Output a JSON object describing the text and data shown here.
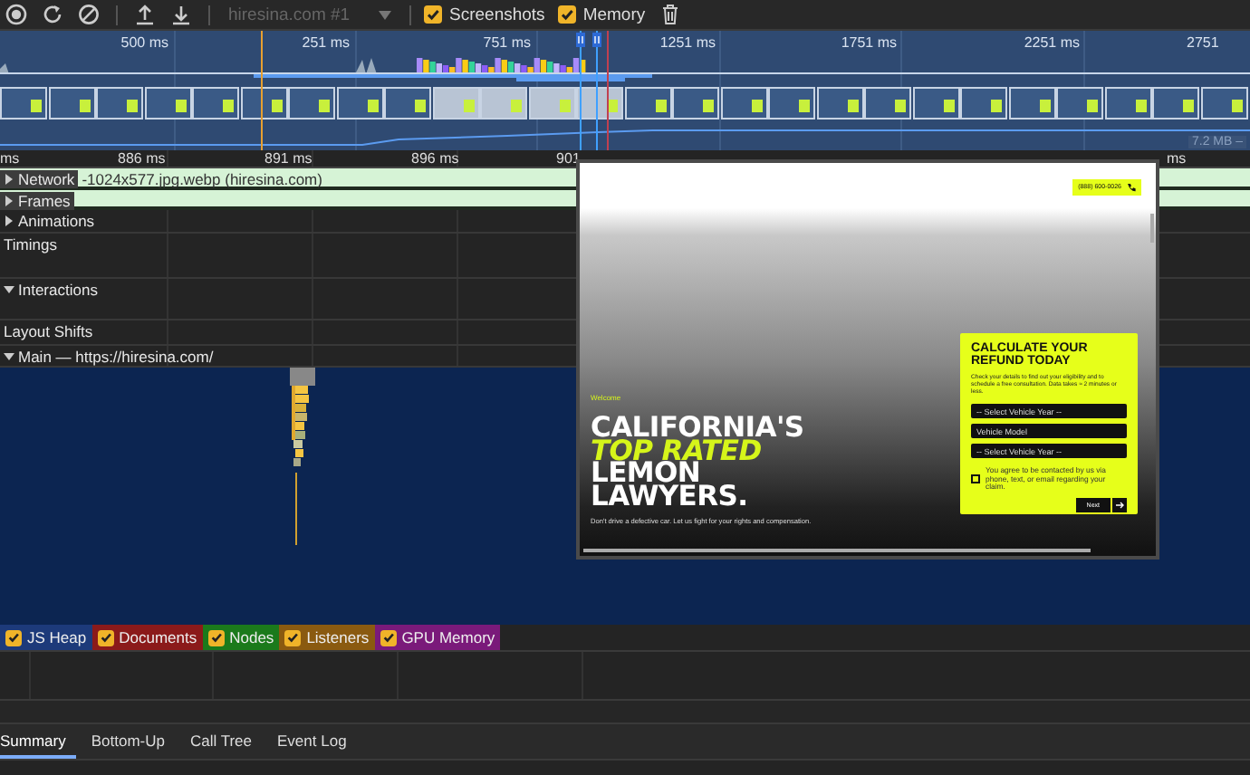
{
  "toolbar": {
    "target": "hiresina.com #1",
    "checkboxes": [
      {
        "label": "Screenshots",
        "checked": true
      },
      {
        "label": "Memory",
        "checked": true
      }
    ]
  },
  "overview": {
    "ticks": [
      "500 ms",
      "251 ms",
      "751 ms",
      "1251 ms",
      "1751 ms",
      "2251 ms",
      "2751"
    ],
    "memory_label": "7.2 MB –"
  },
  "ruler": {
    "ticks": [
      "ms",
      "886 ms",
      "891 ms",
      "896 ms",
      "901",
      "ms"
    ]
  },
  "tracks": [
    {
      "label": "Network",
      "kind": "expandable",
      "expanded": false,
      "highlighted": true,
      "detail": "-1024x577.jpg.webp (hiresina.com)"
    },
    {
      "label": "Frames",
      "kind": "expandable",
      "expanded": false,
      "highlighted": true
    },
    {
      "label": "Animations",
      "kind": "expandable",
      "expanded": false,
      "highlighted": false
    },
    {
      "label": "Timings",
      "kind": "plain",
      "highlighted": false
    },
    {
      "label": "Interactions",
      "kind": "expandable",
      "expanded": true,
      "highlighted": false
    },
    {
      "label": "Layout Shifts",
      "kind": "plain",
      "highlighted": false
    },
    {
      "label": "Main — https://hiresina.com/",
      "kind": "expandable",
      "expanded": true,
      "highlighted": false
    }
  ],
  "screenshot_preview": {
    "phone": "(888) 600-0026",
    "welcome": "Welcome",
    "headline": [
      {
        "text": "CALIFORNIA'S",
        "accent": false
      },
      {
        "text": "TOP RATED",
        "accent": true
      },
      {
        "text": "LEMON",
        "accent": false
      },
      {
        "text": "LAWYERS.",
        "accent": false
      }
    ],
    "tagline": "Don't drive a defective car. Let us fight for your rights and compensation.",
    "form": {
      "title": "CALCULATE YOUR REFUND TODAY",
      "intro": "Check your details to find out your eligibility and to schedule a free consultation. Data takes ≈ 2 minutes or less.",
      "fields": [
        "-- Select Vehicle Year --",
        "Vehicle Model",
        "-- Select Vehicle Year --"
      ],
      "agreed": false,
      "consent": "You agree to be contacted by us via phone, text, or email regarding your claim.",
      "submit": "Next"
    }
  },
  "counters": [
    {
      "label": "JS Heap",
      "color": "#1d3a7a",
      "checked": true
    },
    {
      "label": "Documents",
      "color": "#8b1a1a",
      "checked": true
    },
    {
      "label": "Nodes",
      "color": "#1b7a1b",
      "checked": true
    },
    {
      "label": "Listeners",
      "color": "#8a5a10",
      "checked": true
    },
    {
      "label": "GPU Memory",
      "color": "#7a1a7a",
      "checked": true
    }
  ],
  "tabs": [
    {
      "label": "Summary",
      "selected": true
    },
    {
      "label": "Bottom-Up",
      "selected": false
    },
    {
      "label": "Call Tree",
      "selected": false
    },
    {
      "label": "Event Log",
      "selected": false
    }
  ]
}
